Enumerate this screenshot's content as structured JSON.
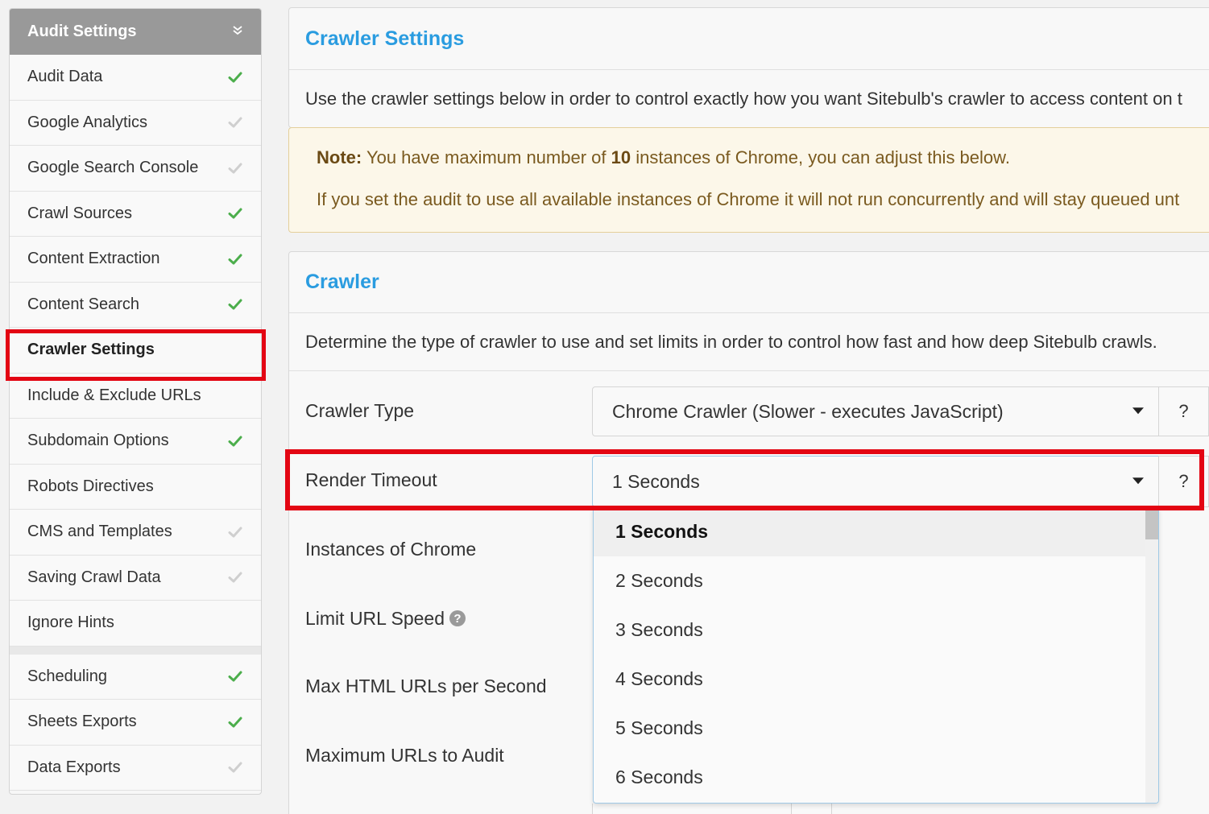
{
  "sidebar": {
    "header": "Audit Settings",
    "items": [
      {
        "label": "Audit Data",
        "status": "complete"
      },
      {
        "label": "Google Analytics",
        "status": "incomplete"
      },
      {
        "label": "Google Search Console",
        "status": "incomplete"
      },
      {
        "label": "Crawl Sources",
        "status": "complete"
      },
      {
        "label": "Content Extraction",
        "status": "complete"
      },
      {
        "label": "Content Search",
        "status": "complete"
      },
      {
        "label": "Crawler Settings",
        "status": "active"
      },
      {
        "label": "Include & Exclude URLs",
        "status": "none"
      },
      {
        "label": "Subdomain Options",
        "status": "complete"
      },
      {
        "label": "Robots Directives",
        "status": "none"
      },
      {
        "label": "CMS and Templates",
        "status": "incomplete"
      },
      {
        "label": "Saving Crawl Data",
        "status": "incomplete"
      },
      {
        "label": "Ignore Hints",
        "status": "none"
      }
    ],
    "items2": [
      {
        "label": "Scheduling",
        "status": "complete"
      },
      {
        "label": "Sheets Exports",
        "status": "complete"
      },
      {
        "label": "Data Exports",
        "status": "incomplete"
      }
    ]
  },
  "crawler_settings": {
    "title": "Crawler Settings",
    "description": "Use the crawler settings below in order to control exactly how you want Sitebulb's crawler to access content on t"
  },
  "note": {
    "label": "Note:",
    "line1_pre": "You have maximum number of",
    "line1_num": "10",
    "line1_post": "instances of Chrome, you can adjust this below.",
    "line2": "If you set the audit to use all available instances of Chrome it will not run concurrently and will stay queued unt"
  },
  "crawler": {
    "title": "Crawler",
    "description": "Determine the type of crawler to use and set limits in order to control how fast and how deep Sitebulb crawls.",
    "rows": {
      "crawler_type": "Crawler Type",
      "render_timeout": "Render Timeout",
      "instances": "Instances of Chrome",
      "limit_speed": "Limit URL Speed",
      "max_html": "Max HTML URLs per Second",
      "max_urls": "Maximum URLs to Audit"
    },
    "crawler_type_value": "Chrome Crawler (Slower - executes JavaScript)",
    "render_timeout_value": "1 Seconds",
    "help_label": "?",
    "help_icon": "?",
    "render_options": [
      "1 Seconds",
      "2 Seconds",
      "3 Seconds",
      "4 Seconds",
      "5 Seconds",
      "6 Seconds"
    ]
  },
  "colors": {
    "accent": "#2a9ce0",
    "check_complete": "#4cae4c",
    "check_incomplete": "#cfcfcf",
    "highlight": "#e30613"
  }
}
